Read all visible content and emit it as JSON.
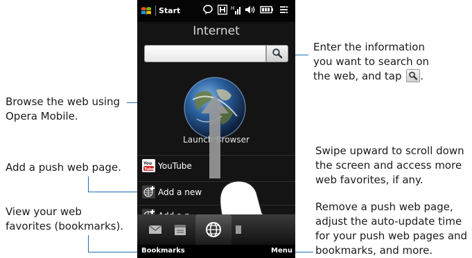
{
  "status_bar": {
    "start_label": "Start"
  },
  "screen": {
    "title": "Internet"
  },
  "search": {
    "placeholder": ""
  },
  "launch_browser_label": "Launch Browser",
  "list": [
    {
      "label": "YouTube",
      "icon": "youtube-icon"
    },
    {
      "label": "Add a new",
      "icon": "add-web-icon"
    },
    {
      "label": "Add a n",
      "icon": "add-web-icon"
    }
  ],
  "softkeys": {
    "left": "Bookmarks",
    "right": "Menu"
  },
  "annotations": {
    "search_line1": "Enter the information",
    "search_line2": "you want to search on",
    "search_line3_prefix": "the web, and tap",
    "search_line3_suffix": ".",
    "browse_line1": "Browse the web using",
    "browse_line2": "Opera Mobile.",
    "add_push": "Add a push web page.",
    "swipe_line1": "Swipe upward to scroll down",
    "swipe_line2": "the screen and access more",
    "swipe_line3": "web favorites, if any.",
    "view_line1": "View your web",
    "view_line2": "favorites (bookmarks).",
    "remove_line1": "Remove a push web page,",
    "remove_line2": "adjust the auto-update time",
    "remove_line3": "for your push web pages and",
    "remove_line4": "bookmarks, and more."
  }
}
